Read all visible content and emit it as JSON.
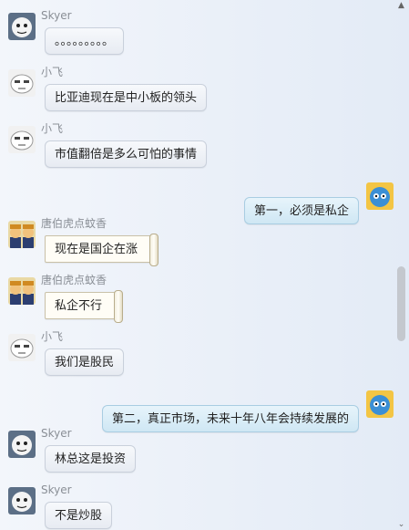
{
  "messages": [
    {
      "side": "left",
      "sender": "Skyer",
      "avatar": "skyer-avatar",
      "text": "。。。。。。。。。",
      "style": "normal"
    },
    {
      "side": "left",
      "sender": "小飞",
      "avatar": "xiaofei-avatar",
      "text": "比亚迪现在是中小板的领头",
      "style": "normal"
    },
    {
      "side": "left",
      "sender": "小飞",
      "avatar": "xiaofei-avatar",
      "text": "市值翻倍是多么可怕的事情",
      "style": "normal"
    },
    {
      "side": "right",
      "sender": "",
      "avatar": "self-avatar",
      "text": "第一，必须是私企",
      "style": "normal"
    },
    {
      "side": "left",
      "sender": "唐伯虎点蚊香",
      "avatar": "tangbohu-avatar",
      "text": "现在是国企在涨",
      "style": "scroll"
    },
    {
      "side": "left",
      "sender": "唐伯虎点蚊香",
      "avatar": "tangbohu-avatar",
      "text": "私企不行",
      "style": "scroll"
    },
    {
      "side": "left",
      "sender": "小飞",
      "avatar": "xiaofei-avatar",
      "text": "我们是股民",
      "style": "normal"
    },
    {
      "side": "right",
      "sender": "",
      "avatar": "self-avatar",
      "text": "第二，真正市场，未来十年八年会持续发展的",
      "style": "normal"
    },
    {
      "side": "left",
      "sender": "Skyer",
      "avatar": "skyer-avatar",
      "text": "林总这是投资",
      "style": "normal"
    },
    {
      "side": "left",
      "sender": "Skyer",
      "avatar": "skyer-avatar",
      "text": "不是炒股",
      "style": "normal"
    }
  ],
  "scrollbar": {
    "up_arrow": "▲",
    "down_arrow": "⌄"
  }
}
